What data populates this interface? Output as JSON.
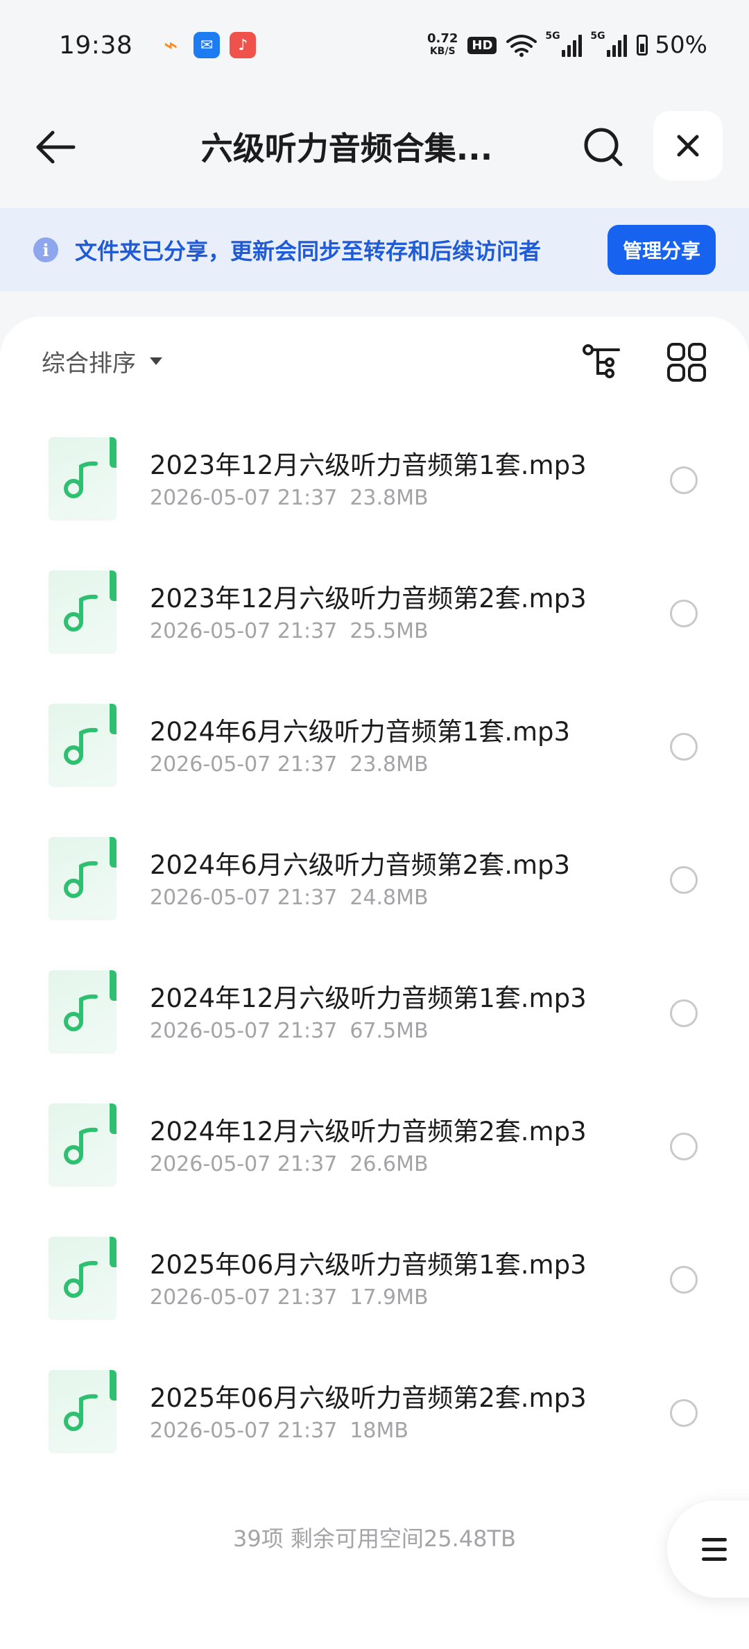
{
  "status_bar": {
    "time": "19:38",
    "apps": [
      {
        "icon": "app-orange-icon",
        "glyph": "⌁",
        "color": "#ff8a1f"
      },
      {
        "icon": "app-mail-icon",
        "glyph": "✉",
        "color": "#1e7cf2"
      },
      {
        "icon": "app-music-icon",
        "glyph": "♪",
        "color": "#f0514b"
      }
    ],
    "net_speed_value": "0.72",
    "net_speed_unit": "KB/S",
    "hd_label": "HD",
    "signal1_label": "5G",
    "signal2_label": "5G",
    "battery_text": "50%"
  },
  "nav": {
    "title": "六级听力音频合集...",
    "back_icon": "back-arrow-icon",
    "search_icon": "search-icon",
    "close_icon": "close-icon"
  },
  "share_banner": {
    "info_glyph": "i",
    "text": "文件夹已分享，更新会同步至转存和后续访问者",
    "button_label": "管理分享"
  },
  "toolbar": {
    "sort_label": "综合排序"
  },
  "files": [
    {
      "name": "2023年12月六级听力音频第1套.mp3",
      "date": "2026-05-07 21:37",
      "size": "23.8MB"
    },
    {
      "name": "2023年12月六级听力音频第2套.mp3",
      "date": "2026-05-07 21:37",
      "size": "25.5MB"
    },
    {
      "name": "2024年6月六级听力音频第1套.mp3",
      "date": "2026-05-07 21:37",
      "size": "23.8MB"
    },
    {
      "name": "2024年6月六级听力音频第2套.mp3",
      "date": "2026-05-07 21:37",
      "size": "24.8MB"
    },
    {
      "name": "2024年12月六级听力音频第1套.mp3",
      "date": "2026-05-07 21:37",
      "size": "67.5MB"
    },
    {
      "name": "2024年12月六级听力音频第2套.mp3",
      "date": "2026-05-07 21:37",
      "size": "26.6MB"
    },
    {
      "name": "2025年06月六级听力音频第1套.mp3",
      "date": "2026-05-07 21:37",
      "size": "17.9MB"
    },
    {
      "name": "2025年06月六级听力音频第2套.mp3",
      "date": "2026-05-07 21:37",
      "size": "18MB"
    }
  ],
  "footer": {
    "summary": "39项 剩余可用空间25.48TB"
  },
  "colors": {
    "accent": "#1763f0",
    "banner_bg": "#e9eefb",
    "audio_green": "#2fbf71"
  }
}
